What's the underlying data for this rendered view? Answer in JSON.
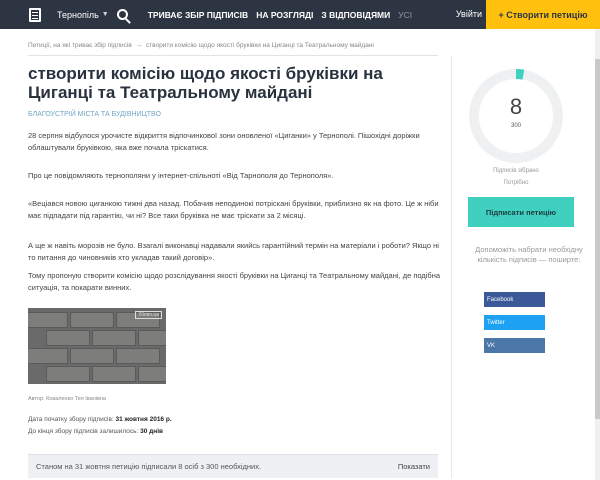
{
  "header": {
    "city": "Тернопіль",
    "nav": [
      {
        "label": "Триває збір підписів"
      },
      {
        "label": "На розгляді"
      },
      {
        "label": "З відповідями"
      },
      {
        "label": "Усі"
      }
    ],
    "login": "Увійти",
    "create": "+ Створити петицію"
  },
  "breadcrumb": {
    "parent": "Петиції, на які триває збір підписів",
    "separator": "→",
    "current": "створити комісію щодо якості бруківки на Циганці та Театральному майдані"
  },
  "petition": {
    "title": "створити комісію щодо якості бруківки на Циганці та Театральному майдані",
    "category": "Благоустрій міста та будівництво",
    "paragraphs": [
      "28 серпня відбулося урочисте відкриття відпочинкової зони оновленої «Циганки» у Тернополі. Пішохідні доріжки облаштували бруківкою, яка вже почала тріскатися.",
      "Про це повідомляють тернополяни у інтернет-спільноті «Від Тарнополя до Тернополя».",
      "«Веціався новою циганкою тижні два назад. Побачив неподинокі потріскані бруківки, приблизно як на фото. Це ж ніби має підпадати під гарантію, чи ні? Все таки бруківка не має тріскати за 2 місяці.",
      "А ще ж навіть морозів не було. Взагалі виконавці надавали якийсь гарантійний термін на матеріали і роботи? Якщо ні то питання до чиновників хто укладав такий договір».",
      "Тому пропоную створити комісію щодо розслідування якості бруківки на Циганці та Театральному майдані, де подібна ситуація, та покарати винних."
    ],
    "photo_watermark": "20min.ua",
    "photo_caption": "Автор: Коваленко Тея Іванівна",
    "start_label": "Дата початку збору підписів:",
    "start_date": "31 жовтня 2016 р.",
    "remaining_label": "До кінця збору підписів залишилось:",
    "remaining_days": "30 днів",
    "status_text": "Станом на 31 жовтня петицію підписали 8 осіб з 300 необхідних.",
    "show_label": "Показати"
  },
  "sidebar": {
    "collected": 8,
    "needed": 300,
    "collected_label": "Підписів зібрано",
    "needed_label": "Потрібно",
    "sign_button": "Підписати петицію",
    "share_help": "Допоможіть набрати необхідну кількість підписів — поширте:",
    "share": [
      {
        "label": "Facebook",
        "color": "#3b5998"
      },
      {
        "label": "Twitter",
        "color": "#1da1f2"
      },
      {
        "label": "VK",
        "color": "#4a76a8"
      }
    ],
    "accent": "#3fd0c0"
  }
}
